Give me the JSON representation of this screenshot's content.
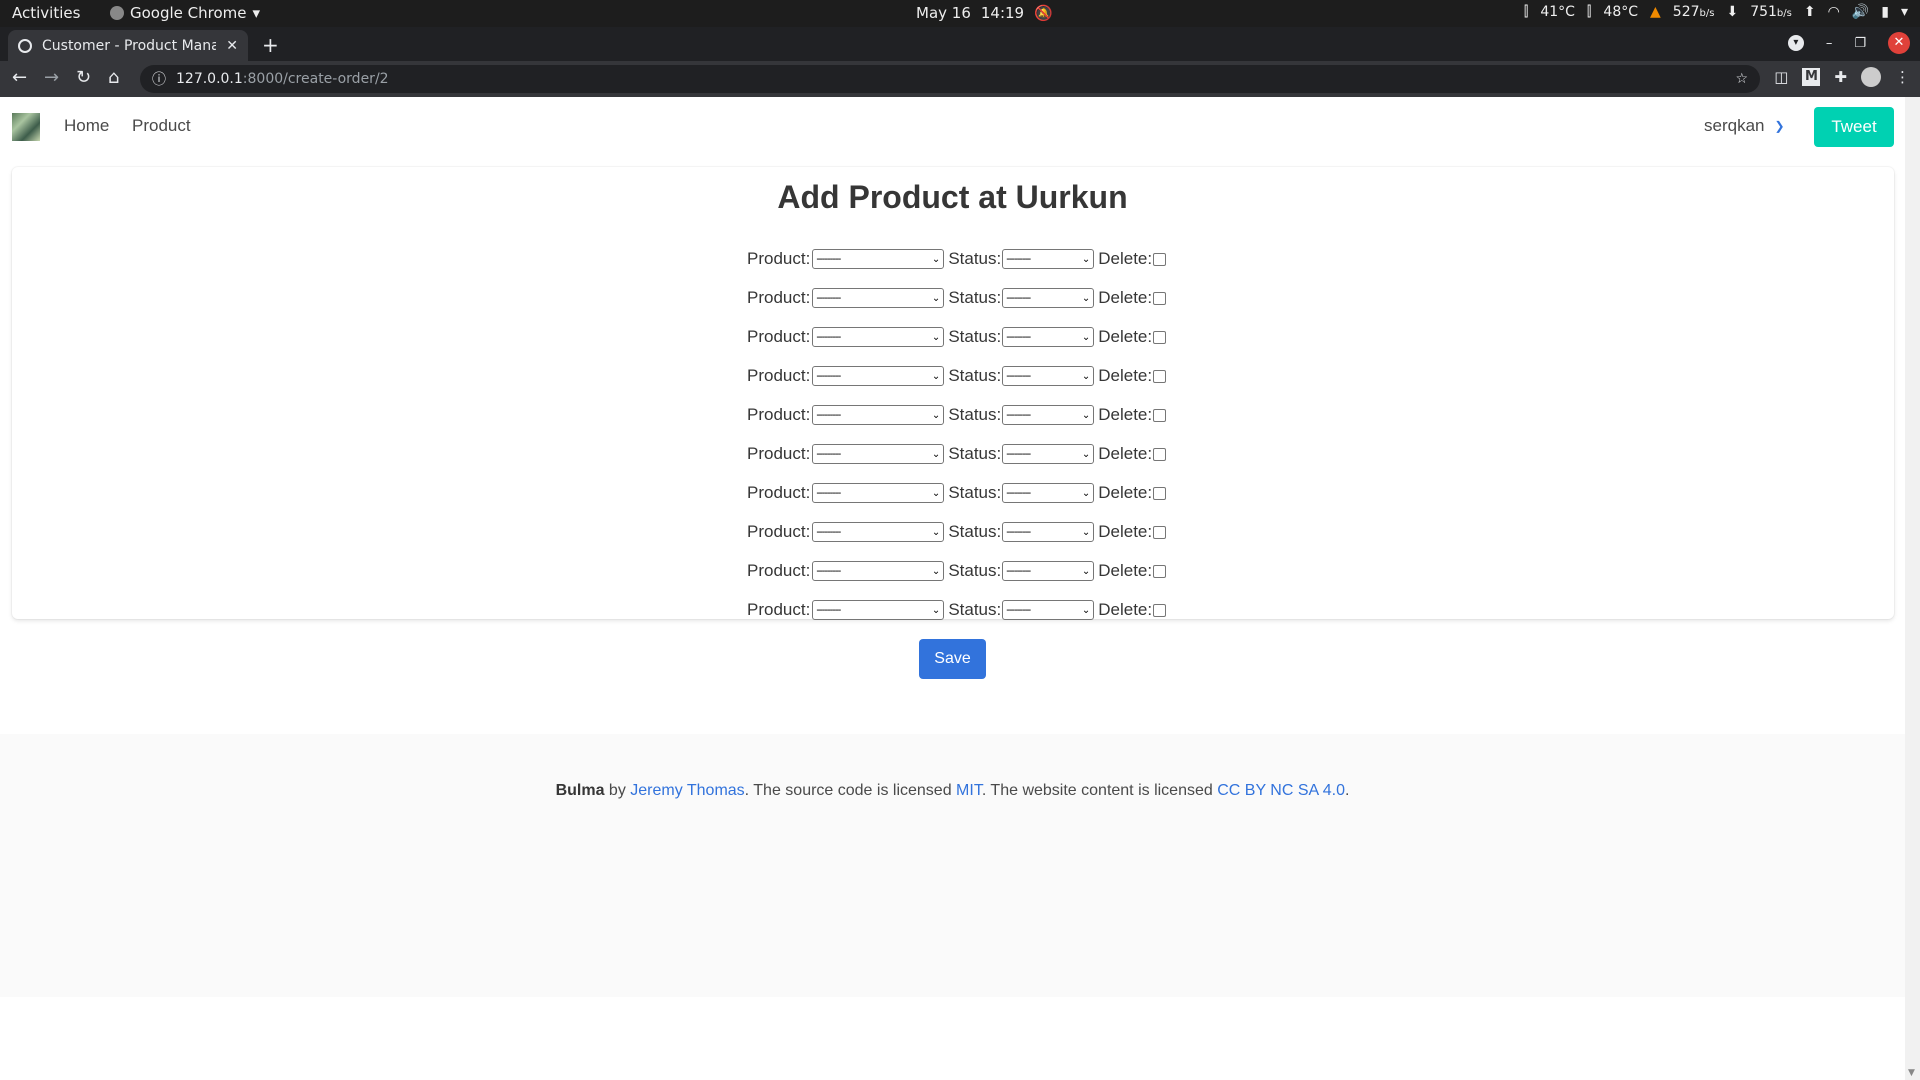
{
  "system": {
    "activities": "Activities",
    "app_name": "Google Chrome",
    "date": "May 16",
    "time": "14:19",
    "temp1": "41°C",
    "temp2": "48°C",
    "net_down": "527",
    "net_up": "751",
    "net_unit": "b/s"
  },
  "browser": {
    "tab_title": "Customer - Product Mana",
    "url_host": "127.0.0.1",
    "url_path": ":8000/create-order/2"
  },
  "navbar": {
    "home": "Home",
    "product": "Product",
    "user": "serqkan",
    "tweet": "Tweet"
  },
  "main": {
    "title": "Add Product at Uurkun",
    "product_label": "Product:",
    "status_label": "Status:",
    "delete_label": "Delete:",
    "rows": [
      {
        "product": "---------",
        "status": "---------",
        "delete": false
      },
      {
        "product": "---------",
        "status": "---------",
        "delete": false
      },
      {
        "product": "---------",
        "status": "---------",
        "delete": false
      },
      {
        "product": "---------",
        "status": "---------",
        "delete": false
      },
      {
        "product": "---------",
        "status": "---------",
        "delete": false
      },
      {
        "product": "---------",
        "status": "---------",
        "delete": false
      },
      {
        "product": "---------",
        "status": "---------",
        "delete": false
      },
      {
        "product": "---------",
        "status": "---------",
        "delete": false
      },
      {
        "product": "---------",
        "status": "---------",
        "delete": false
      },
      {
        "product": "---------",
        "status": "---------",
        "delete": false
      }
    ],
    "save": "Save"
  },
  "footer": {
    "bulma": "Bulma",
    "by": " by ",
    "author": "Jeremy Thomas",
    "text1": ". The source code is licensed ",
    "mit": "MIT",
    "text2": ". The website content is licensed ",
    "cc": "CC BY NC SA 4.0",
    "text3": "."
  },
  "colors": {
    "primary": "#00d1b2",
    "link": "#3273dc"
  }
}
